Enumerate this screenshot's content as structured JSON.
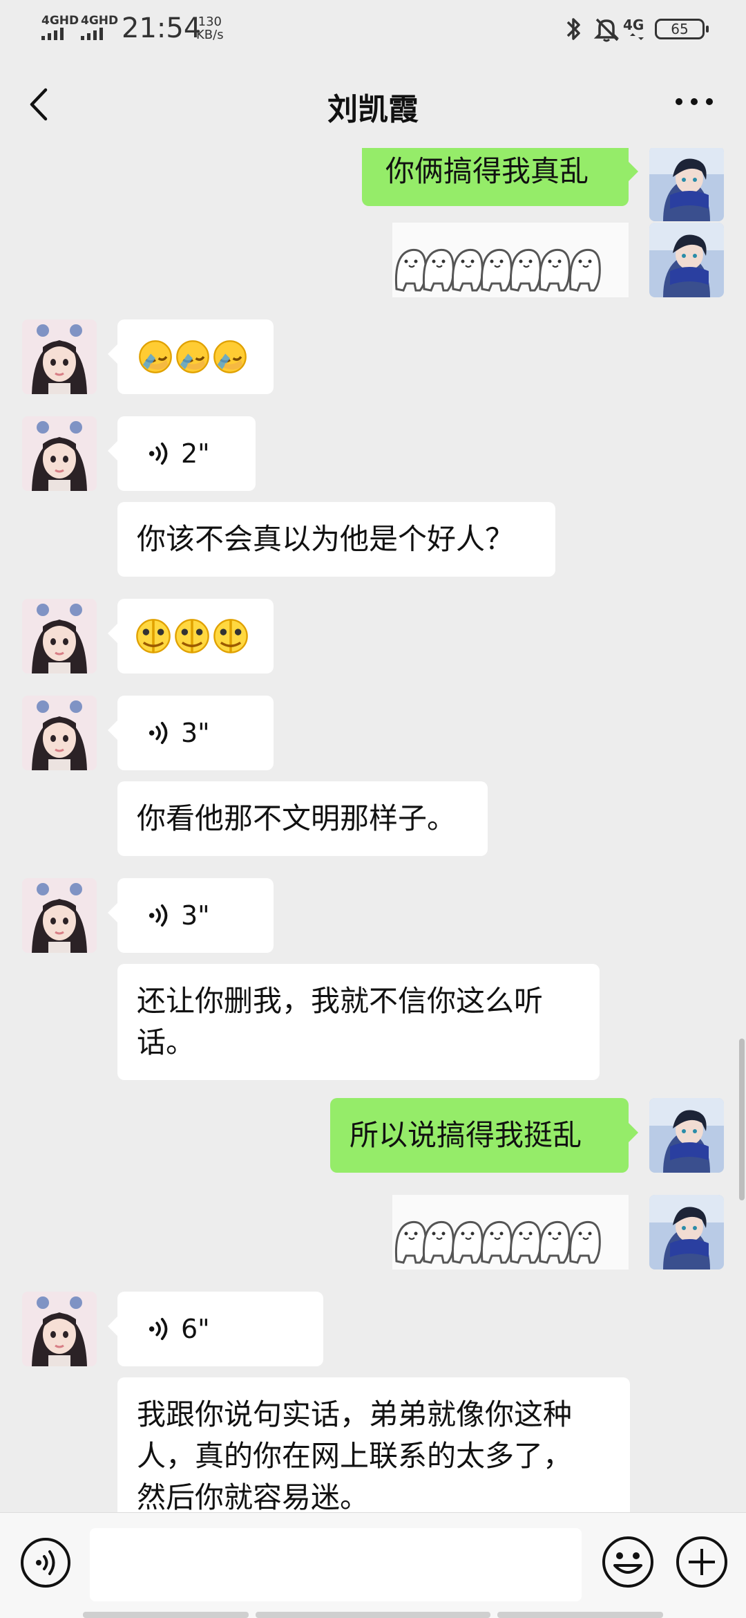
{
  "status_bar": {
    "network_1": "4GHD",
    "network_2": "4GHD",
    "time": "21:54",
    "speed_value": "130",
    "speed_unit": "KB/s",
    "right_network": "4G",
    "battery": "65",
    "icons": [
      "bluetooth-icon",
      "bell-muted-icon",
      "4g-icon",
      "battery-icon"
    ]
  },
  "header": {
    "title": "刘凯霞",
    "back_icon": "chevron-left-icon",
    "more_icon": "more-dots-icon"
  },
  "messages": [
    {
      "side": "out",
      "kind": "text",
      "text": "你俩搞得我真乱"
    },
    {
      "side": "out",
      "kind": "sticker",
      "sticker": "row-of-cartoon-blobs-sticker"
    },
    {
      "side": "in",
      "kind": "emoji",
      "emoji": [
        "facepalm-emoji",
        "facepalm-emoji",
        "facepalm-emoji"
      ]
    },
    {
      "side": "in",
      "kind": "voice",
      "duration": "2\""
    },
    {
      "side": "in",
      "kind": "text",
      "text": "你该不会真以为他是个好人？"
    },
    {
      "side": "in",
      "kind": "emoji",
      "emoji": [
        "cracked-face-emoji",
        "cracked-face-emoji",
        "cracked-face-emoji"
      ]
    },
    {
      "side": "in",
      "kind": "voice",
      "duration": "3\""
    },
    {
      "side": "in",
      "kind": "text",
      "text": "你看他那不文明那样子。"
    },
    {
      "side": "in",
      "kind": "voice",
      "duration": "3\""
    },
    {
      "side": "in",
      "kind": "text",
      "text": "还让你删我，我就不信你这么听\n话。"
    },
    {
      "side": "out",
      "kind": "text",
      "text": "所以说搞得我挺乱"
    },
    {
      "side": "out",
      "kind": "sticker",
      "sticker": "row-of-cartoon-blobs-sticker"
    },
    {
      "side": "in",
      "kind": "voice",
      "duration": "6\""
    },
    {
      "side": "in",
      "kind": "text",
      "text": "我跟你说句实话，弟弟就像你这种\n人，真的你在网上联系的太多了，\n然后你就容易迷。"
    }
  ],
  "input_bar": {
    "placeholder": "",
    "voice_icon": "voice-mode-icon",
    "emoji_icon": "emoji-icon",
    "plus_icon": "plus-icon"
  },
  "colors": {
    "background": "#ededed",
    "outgoing_bubble": "#95ec69",
    "incoming_bubble": "#ffffff"
  }
}
